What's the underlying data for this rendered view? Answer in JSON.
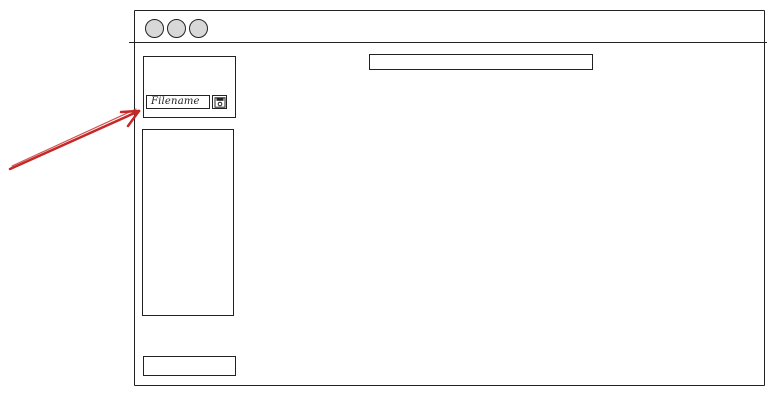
{
  "window": {
    "controls": [
      "window-control-1",
      "window-control-2",
      "window-control-3"
    ]
  },
  "sidebar": {
    "filename_field": {
      "value": "Filename"
    },
    "save_icon": "floppy-disk-icon"
  },
  "annotation": {
    "arrow_color": "#c62828"
  },
  "colors": {
    "stroke": "#222222",
    "control_fill": "#d8d8d8",
    "arrow": "#c62828"
  }
}
